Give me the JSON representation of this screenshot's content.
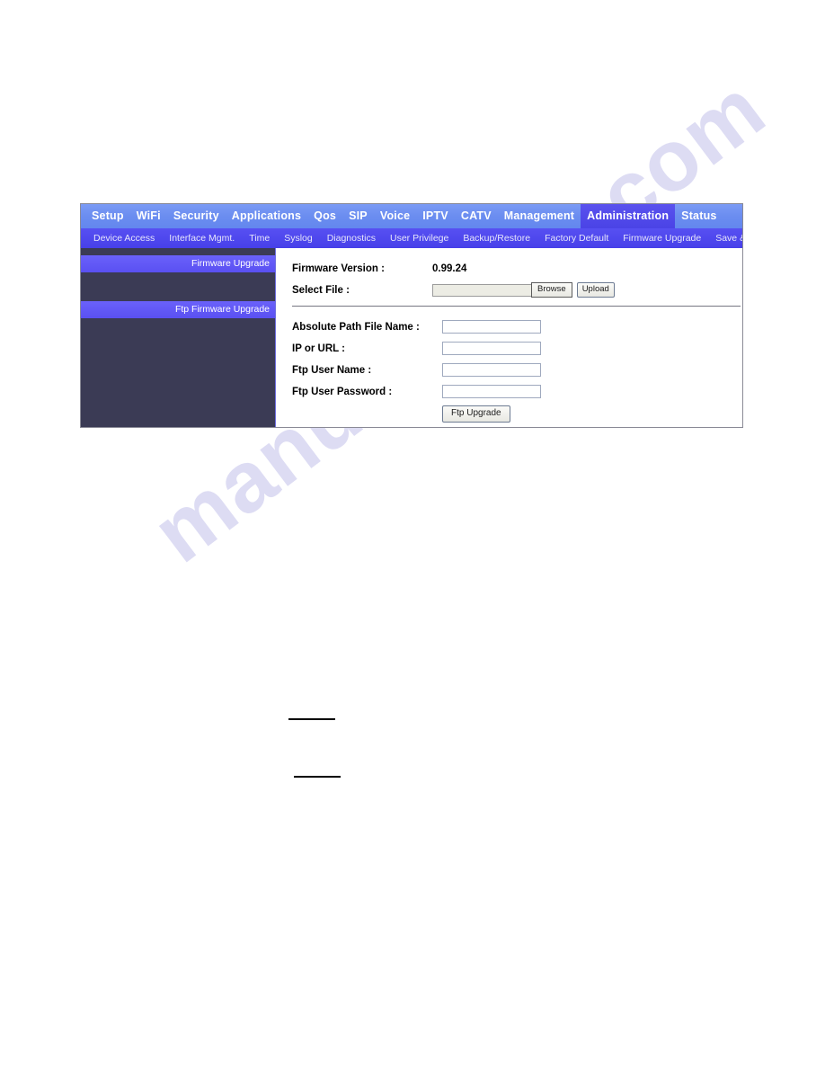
{
  "page": {
    "watermark": "manualshive.com"
  },
  "topnav": {
    "items": [
      {
        "label": "Setup",
        "active": false
      },
      {
        "label": "WiFi",
        "active": false
      },
      {
        "label": "Security",
        "active": false
      },
      {
        "label": "Applications",
        "active": false
      },
      {
        "label": "Qos",
        "active": false
      },
      {
        "label": "SIP",
        "active": false
      },
      {
        "label": "Voice",
        "active": false
      },
      {
        "label": "IPTV",
        "active": false
      },
      {
        "label": "CATV",
        "active": false
      },
      {
        "label": "Management",
        "active": false
      },
      {
        "label": "Administration",
        "active": true
      },
      {
        "label": "Status",
        "active": false
      }
    ]
  },
  "subnav": {
    "items": [
      {
        "label": "Device Access"
      },
      {
        "label": "Interface Mgmt."
      },
      {
        "label": "Time"
      },
      {
        "label": "Syslog"
      },
      {
        "label": "Diagnostics"
      },
      {
        "label": "User Privilege"
      },
      {
        "label": "Backup/Restore"
      },
      {
        "label": "Factory Default"
      },
      {
        "label": "Firmware Upgrade"
      },
      {
        "label": "Save & Logout"
      }
    ]
  },
  "sidebar": {
    "headings": [
      {
        "label": "Firmware Upgrade"
      },
      {
        "label": "Ftp Firmware Upgrade"
      }
    ]
  },
  "firmware_upgrade": {
    "version_label": "Firmware Version :",
    "version_value": "0.99.24",
    "select_file_label": "Select File :",
    "select_file_value": "",
    "select_file_placeholder": "",
    "browse_label": "Browse",
    "upload_label": "Upload"
  },
  "ftp_upgrade": {
    "fields": [
      {
        "label": "Absolute Path File Name :",
        "value": "",
        "name": "absolute-path-file-name-field"
      },
      {
        "label": "IP or URL :",
        "value": "",
        "name": "ip-or-url-field"
      },
      {
        "label": "Ftp User Name :",
        "value": "",
        "name": "ftp-user-name-field"
      },
      {
        "label": "Ftp User Password :",
        "value": "",
        "name": "ftp-user-password-field"
      }
    ],
    "submit_label": "Ftp Upgrade"
  },
  "colors": {
    "topnav_bg": "#6c90f0",
    "topnav_active": "#4540e8",
    "subnav_bg": "#4b44ee",
    "sidebar_bg": "#3b3b55",
    "sidebar_heading_bg": "#5b52f5",
    "watermark": "#d8d7f2"
  }
}
